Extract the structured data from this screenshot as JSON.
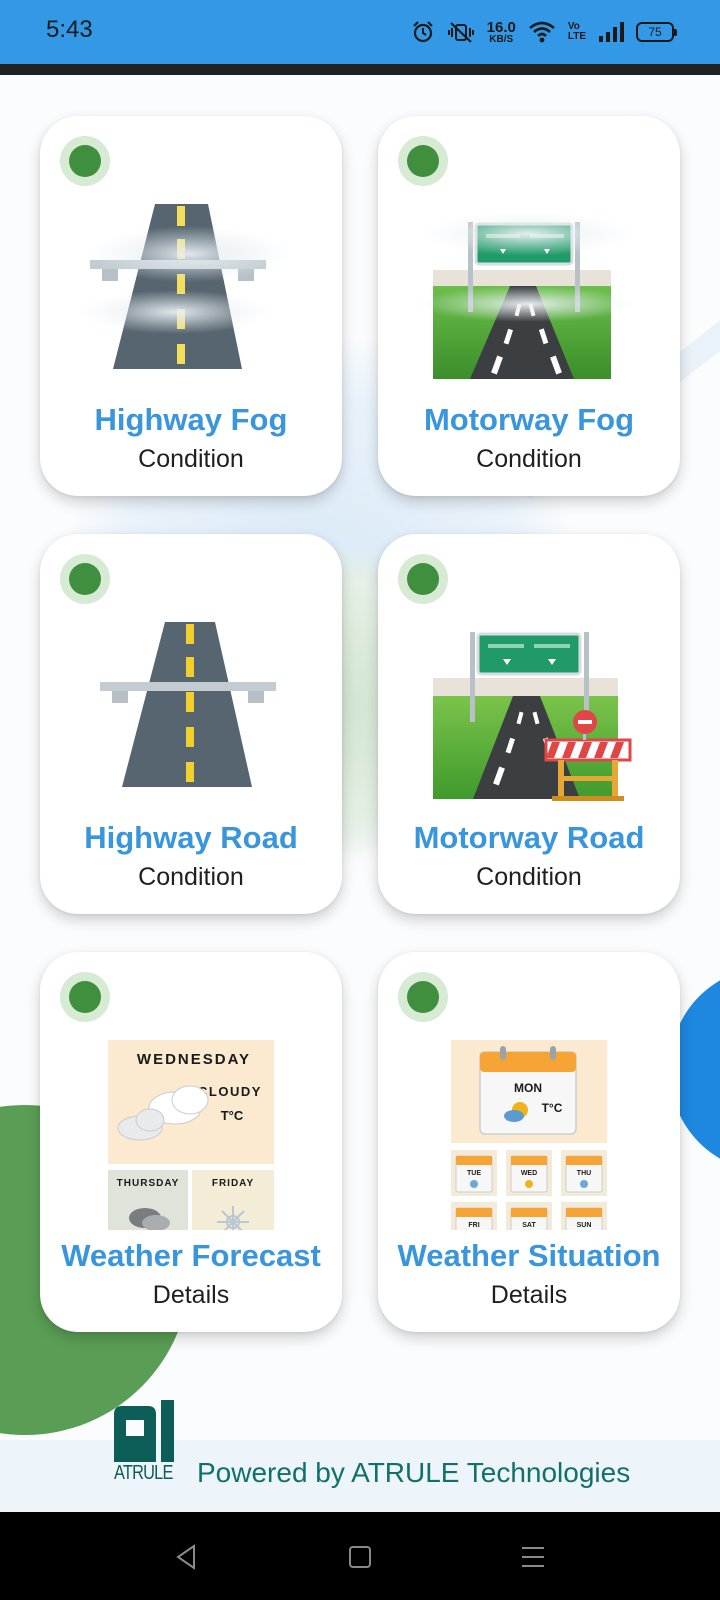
{
  "status_bar": {
    "time": "5:43",
    "net_speed_value": "16.0",
    "net_speed_unit": "KB/S",
    "volte_top": "Vo",
    "volte_bottom": "LTE",
    "battery": "75",
    "icons": [
      "alarm-icon",
      "vibrate-icon",
      "wifi-icon",
      "signal-icon",
      "battery-icon"
    ],
    "color": "#3399e6"
  },
  "cards": [
    {
      "title": "Highway Fog",
      "subtitle": "Condition",
      "icon": "highway-fog-icon"
    },
    {
      "title": "Motorway Fog",
      "subtitle": "Condition",
      "icon": "motorway-fog-icon"
    },
    {
      "title": "Highway Road",
      "subtitle": "Condition",
      "icon": "highway-road-icon"
    },
    {
      "title": "Motorway Road",
      "subtitle": "Condition",
      "icon": "motorway-road-icon"
    },
    {
      "title": "Weather Forecast",
      "subtitle": "Details",
      "icon": "weather-forecast-icon"
    },
    {
      "title": "Weather Situation",
      "subtitle": "Details",
      "icon": "weather-situation-icon"
    }
  ],
  "forecast_art": {
    "day": "WEDNESDAY",
    "condition": "CLOUDY",
    "temp": "T°C",
    "day2": "THURSDAY",
    "day3": "FRIDAY"
  },
  "situation_art": {
    "main_day": "MON",
    "temp": "T°C",
    "days": [
      "TUE",
      "WED",
      "THU",
      "FRI",
      "SAT",
      "SUN"
    ]
  },
  "footer": {
    "logo_word": "ATRULE",
    "powered_by": "Powered by ATRULE Technologies"
  },
  "colors": {
    "accent": "#3a96dc",
    "status_dot": "#3f8f3e",
    "footer_text": "#11706a"
  },
  "nav": {
    "buttons": [
      "back-icon",
      "home-icon",
      "recents-icon"
    ]
  }
}
